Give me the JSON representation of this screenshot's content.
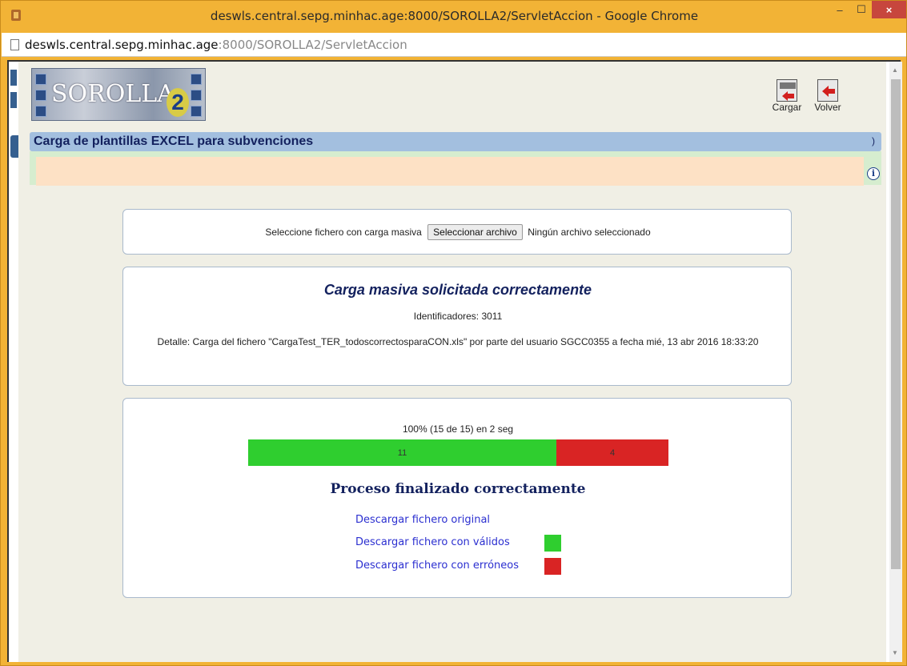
{
  "window": {
    "title": "deswls.central.sepg.minhac.age:8000/SOROLLA2/ServletAccion - Google Chrome",
    "controls": {
      "minimize": "–",
      "maximize": "☐",
      "close": "×"
    }
  },
  "urlbar": {
    "host": "deswls.central.sepg.minhac.age",
    "path": ":8000/SOROLLA2/ServletAccion"
  },
  "logo": {
    "text": "SOROLLA",
    "number": "2"
  },
  "toolbar": {
    "cargar_label": "Cargar",
    "volver_label": "Volver"
  },
  "header": {
    "title": "Carga de plantillas EXCEL para subvenciones",
    "right_mark": ")"
  },
  "info_icon": "i",
  "file_panel": {
    "label": "Seleccione fichero con carga masiva",
    "button": "Seleccionar archivo",
    "status": "Ningún archivo seleccionado"
  },
  "message_panel": {
    "title": "Carga masiva solicitada correctamente",
    "identifiers": "Identificadores: 3011",
    "detail": "Detalle: Carga del fichero \"CargaTest_TER_todoscorrectosparaCON.xls\" por parte del usuario SGCC0355 a fecha mié, 13 abr 2016 18:33:20"
  },
  "process_panel": {
    "progress_text": "100% (15 de 15) en 2 seg",
    "progress": {
      "total": 15,
      "valid": 11,
      "errors": 4
    },
    "valid_label": "11",
    "error_label": "4",
    "status_title": "Proceso finalizado correctamente",
    "downloads": {
      "original": "Descargar fichero original",
      "valid": "Descargar fichero con válidos",
      "errors": "Descargar fichero con erróneos"
    },
    "colors": {
      "valid": "#2fce2f",
      "errors": "#d92424"
    }
  }
}
